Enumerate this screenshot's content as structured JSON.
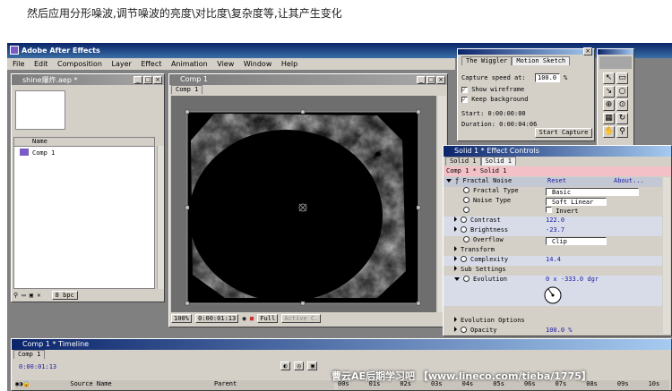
{
  "caption": "然后应用分形噪波,调节噪波的亮度\\对比度\\复杂度等,让其产生变化",
  "app": {
    "title": "Adobe After Effects"
  },
  "menu": [
    "File",
    "Edit",
    "Composition",
    "Layer",
    "Effect",
    "Animation",
    "View",
    "Window",
    "Help"
  ],
  "project": {
    "title": "shine爆炸.aep *",
    "col_name": "Name",
    "item": "Comp 1",
    "bpc": "8 bpc"
  },
  "comp": {
    "title": "Comp 1",
    "tab": "Comp 1",
    "zoom": "100%",
    "timecode": "0:00:01:13",
    "resolution": "Full",
    "camera": "Active C."
  },
  "wiggler": {
    "tab1": "The Wiggler",
    "tab2": "Motion Sketch",
    "capture_label": "Capture speed at:",
    "capture_value": "100.0",
    "capture_unit": "%",
    "show_wireframe": "Show wireframe",
    "keep_background": "Keep background",
    "start": "Start: 0:00:00:00",
    "duration": "Duration: 0:00:04:06",
    "start_capture": "Start Capture"
  },
  "effects": {
    "title": "Solid 1 * Effect Controls",
    "tab1": "Solid 1",
    "tab2": "Solid 1",
    "path": "Comp 1 * Solid 1",
    "effect_name": "Fractal Noise",
    "reset": "Reset",
    "about": "About...",
    "props": [
      {
        "label": "Fractal Type",
        "value": "Basic"
      },
      {
        "label": "Noise Type",
        "value": "Soft Linear"
      },
      {
        "label": "",
        "value": "Invert"
      },
      {
        "label": "Contrast",
        "value": "122.0"
      },
      {
        "label": "Brightness",
        "value": "-23.7"
      },
      {
        "label": "Overflow",
        "value": "Clip"
      },
      {
        "label": "Transform",
        "value": ""
      },
      {
        "label": "Complexity",
        "value": "14.4"
      },
      {
        "label": "Sub Settings",
        "value": ""
      },
      {
        "label": "Evolution",
        "value": "0 x -333.0 dgr"
      },
      {
        "label": "Evolution Options",
        "value": ""
      },
      {
        "label": "Opacity",
        "value": "100.0 %"
      }
    ]
  },
  "timeline": {
    "title": "Comp 1 * Timeline",
    "tab": "Comp 1",
    "timecode": "0:00:01:13",
    "col_source": "Source Name",
    "col_parent": "Parent",
    "ticks": [
      "00s",
      "01s",
      "02s",
      "03s",
      "04s",
      "05s",
      "06s",
      "07s",
      "08s",
      "09s",
      "10s"
    ]
  },
  "watermark": "曹云AE后期学习吧 【www.lineco.com/tieba/1775】",
  "colors": {
    "titlebar": "#0a246a",
    "panel": "#d4d0c8",
    "effect_header": "#f4c0c8",
    "value": "#1a1aa0"
  }
}
